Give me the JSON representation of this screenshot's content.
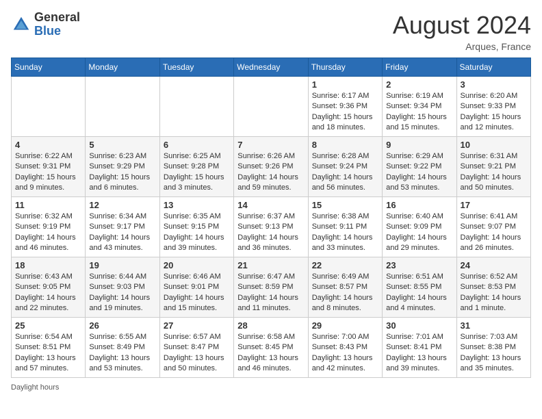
{
  "header": {
    "logo_general": "General",
    "logo_blue": "Blue",
    "month_year": "August 2024",
    "location": "Arques, France"
  },
  "days_of_week": [
    "Sunday",
    "Monday",
    "Tuesday",
    "Wednesday",
    "Thursday",
    "Friday",
    "Saturday"
  ],
  "weeks": [
    [
      {
        "day": "",
        "info": ""
      },
      {
        "day": "",
        "info": ""
      },
      {
        "day": "",
        "info": ""
      },
      {
        "day": "",
        "info": ""
      },
      {
        "day": "1",
        "info": "Sunrise: 6:17 AM\nSunset: 9:36 PM\nDaylight: 15 hours\nand 18 minutes."
      },
      {
        "day": "2",
        "info": "Sunrise: 6:19 AM\nSunset: 9:34 PM\nDaylight: 15 hours\nand 15 minutes."
      },
      {
        "day": "3",
        "info": "Sunrise: 6:20 AM\nSunset: 9:33 PM\nDaylight: 15 hours\nand 12 minutes."
      }
    ],
    [
      {
        "day": "4",
        "info": "Sunrise: 6:22 AM\nSunset: 9:31 PM\nDaylight: 15 hours\nand 9 minutes."
      },
      {
        "day": "5",
        "info": "Sunrise: 6:23 AM\nSunset: 9:29 PM\nDaylight: 15 hours\nand 6 minutes."
      },
      {
        "day": "6",
        "info": "Sunrise: 6:25 AM\nSunset: 9:28 PM\nDaylight: 15 hours\nand 3 minutes."
      },
      {
        "day": "7",
        "info": "Sunrise: 6:26 AM\nSunset: 9:26 PM\nDaylight: 14 hours\nand 59 minutes."
      },
      {
        "day": "8",
        "info": "Sunrise: 6:28 AM\nSunset: 9:24 PM\nDaylight: 14 hours\nand 56 minutes."
      },
      {
        "day": "9",
        "info": "Sunrise: 6:29 AM\nSunset: 9:22 PM\nDaylight: 14 hours\nand 53 minutes."
      },
      {
        "day": "10",
        "info": "Sunrise: 6:31 AM\nSunset: 9:21 PM\nDaylight: 14 hours\nand 50 minutes."
      }
    ],
    [
      {
        "day": "11",
        "info": "Sunrise: 6:32 AM\nSunset: 9:19 PM\nDaylight: 14 hours\nand 46 minutes."
      },
      {
        "day": "12",
        "info": "Sunrise: 6:34 AM\nSunset: 9:17 PM\nDaylight: 14 hours\nand 43 minutes."
      },
      {
        "day": "13",
        "info": "Sunrise: 6:35 AM\nSunset: 9:15 PM\nDaylight: 14 hours\nand 39 minutes."
      },
      {
        "day": "14",
        "info": "Sunrise: 6:37 AM\nSunset: 9:13 PM\nDaylight: 14 hours\nand 36 minutes."
      },
      {
        "day": "15",
        "info": "Sunrise: 6:38 AM\nSunset: 9:11 PM\nDaylight: 14 hours\nand 33 minutes."
      },
      {
        "day": "16",
        "info": "Sunrise: 6:40 AM\nSunset: 9:09 PM\nDaylight: 14 hours\nand 29 minutes."
      },
      {
        "day": "17",
        "info": "Sunrise: 6:41 AM\nSunset: 9:07 PM\nDaylight: 14 hours\nand 26 minutes."
      }
    ],
    [
      {
        "day": "18",
        "info": "Sunrise: 6:43 AM\nSunset: 9:05 PM\nDaylight: 14 hours\nand 22 minutes."
      },
      {
        "day": "19",
        "info": "Sunrise: 6:44 AM\nSunset: 9:03 PM\nDaylight: 14 hours\nand 19 minutes."
      },
      {
        "day": "20",
        "info": "Sunrise: 6:46 AM\nSunset: 9:01 PM\nDaylight: 14 hours\nand 15 minutes."
      },
      {
        "day": "21",
        "info": "Sunrise: 6:47 AM\nSunset: 8:59 PM\nDaylight: 14 hours\nand 11 minutes."
      },
      {
        "day": "22",
        "info": "Sunrise: 6:49 AM\nSunset: 8:57 PM\nDaylight: 14 hours\nand 8 minutes."
      },
      {
        "day": "23",
        "info": "Sunrise: 6:51 AM\nSunset: 8:55 PM\nDaylight: 14 hours\nand 4 minutes."
      },
      {
        "day": "24",
        "info": "Sunrise: 6:52 AM\nSunset: 8:53 PM\nDaylight: 14 hours\nand 1 minute."
      }
    ],
    [
      {
        "day": "25",
        "info": "Sunrise: 6:54 AM\nSunset: 8:51 PM\nDaylight: 13 hours\nand 57 minutes."
      },
      {
        "day": "26",
        "info": "Sunrise: 6:55 AM\nSunset: 8:49 PM\nDaylight: 13 hours\nand 53 minutes."
      },
      {
        "day": "27",
        "info": "Sunrise: 6:57 AM\nSunset: 8:47 PM\nDaylight: 13 hours\nand 50 minutes."
      },
      {
        "day": "28",
        "info": "Sunrise: 6:58 AM\nSunset: 8:45 PM\nDaylight: 13 hours\nand 46 minutes."
      },
      {
        "day": "29",
        "info": "Sunrise: 7:00 AM\nSunset: 8:43 PM\nDaylight: 13 hours\nand 42 minutes."
      },
      {
        "day": "30",
        "info": "Sunrise: 7:01 AM\nSunset: 8:41 PM\nDaylight: 13 hours\nand 39 minutes."
      },
      {
        "day": "31",
        "info": "Sunrise: 7:03 AM\nSunset: 8:38 PM\nDaylight: 13 hours\nand 35 minutes."
      }
    ]
  ],
  "footer": {
    "daylight_label": "Daylight hours"
  }
}
